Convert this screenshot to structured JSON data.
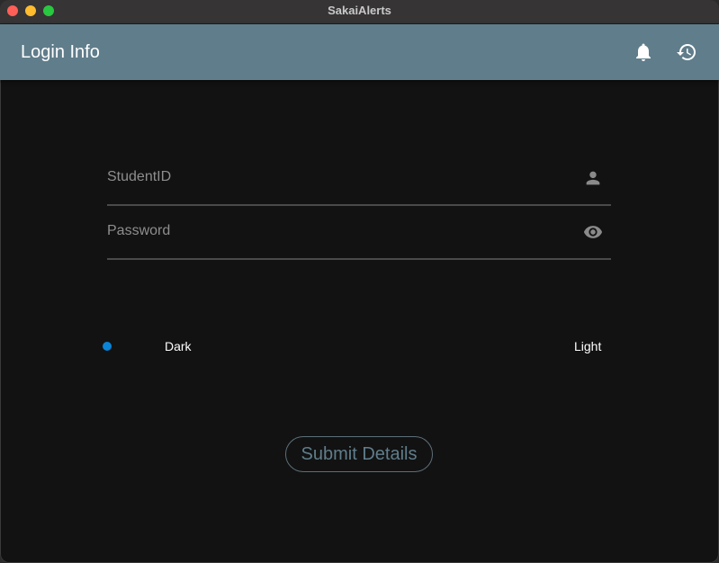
{
  "window": {
    "title": "SakaiAlerts"
  },
  "appbar": {
    "title": "Login Info",
    "color": "#607d8b",
    "actions": [
      {
        "icon": "bell-icon"
      },
      {
        "icon": "history-icon"
      }
    ]
  },
  "form": {
    "student_id": {
      "value": "",
      "placeholder": "StudentID",
      "icon": "person-icon"
    },
    "password": {
      "value": "",
      "placeholder": "Password",
      "icon": "eye-icon"
    }
  },
  "theme": {
    "selected": "Dark",
    "options": [
      "Dark",
      "Light"
    ],
    "dark_label": "Dark",
    "light_label": "Light"
  },
  "submit": {
    "label": "Submit Details"
  },
  "colors": {
    "background": "#121212",
    "accent": "#607d8b",
    "radio": "#0a84d6"
  }
}
